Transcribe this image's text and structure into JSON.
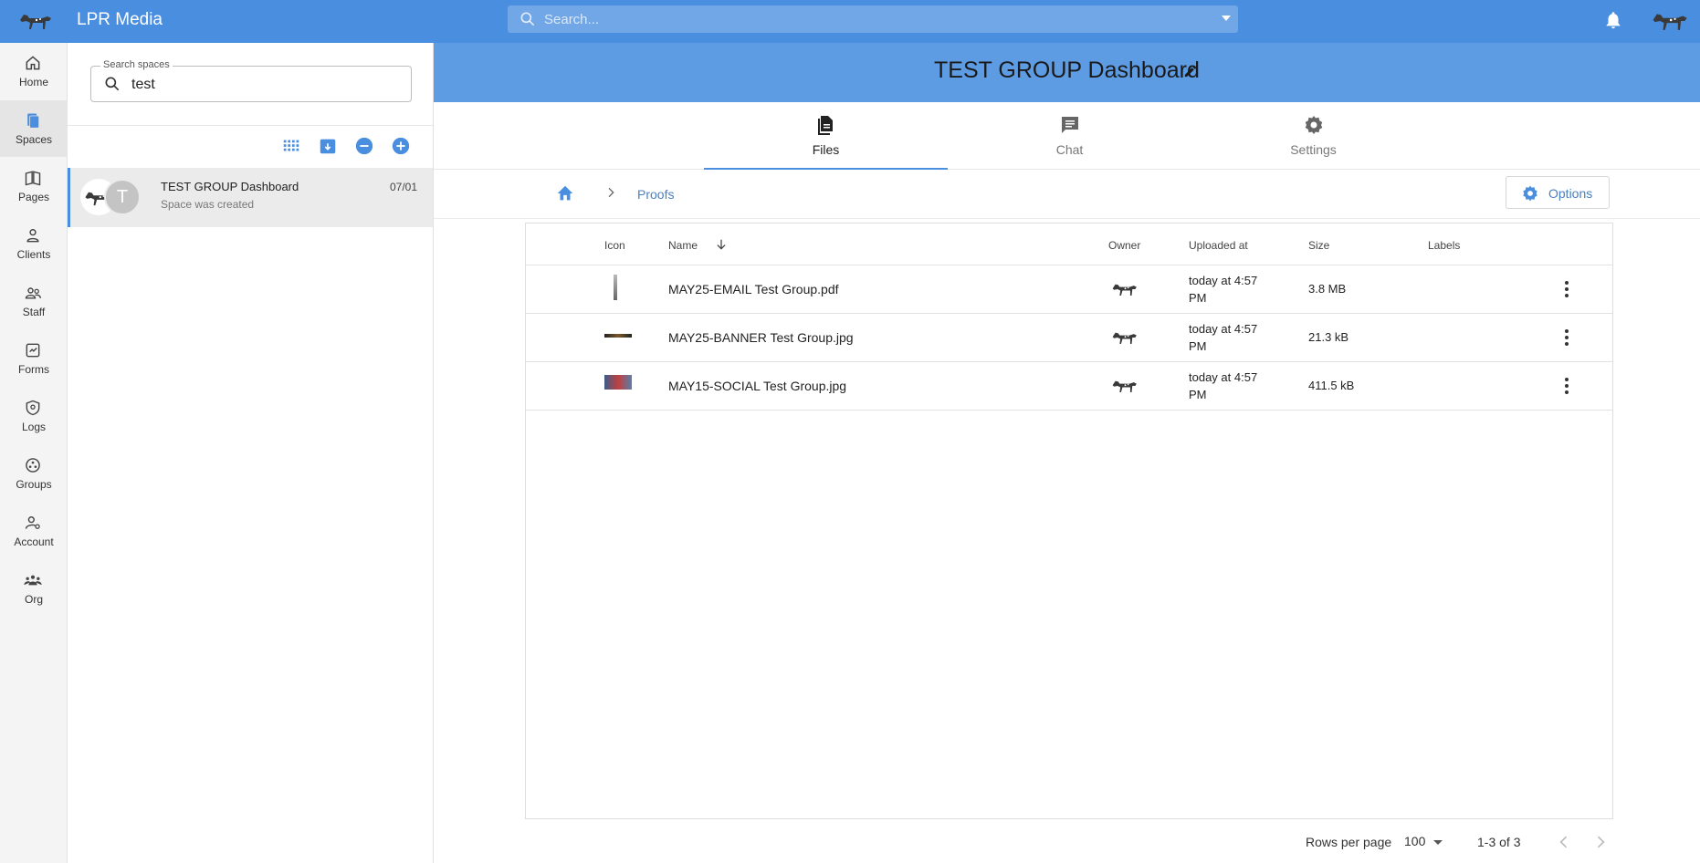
{
  "topbar": {
    "brand": "LPR Media",
    "search_placeholder": "Search..."
  },
  "leftnav": {
    "items": [
      {
        "label": "Home",
        "icon": "home-icon"
      },
      {
        "label": "Spaces",
        "icon": "spaces-icon"
      },
      {
        "label": "Pages",
        "icon": "pages-icon"
      },
      {
        "label": "Clients",
        "icon": "person-icon"
      },
      {
        "label": "Staff",
        "icon": "staff-icon"
      },
      {
        "label": "Forms",
        "icon": "forms-icon"
      },
      {
        "label": "Logs",
        "icon": "shield-icon"
      },
      {
        "label": "Groups",
        "icon": "groups-icon"
      },
      {
        "label": "Account",
        "icon": "account-settings-icon"
      },
      {
        "label": "Org",
        "icon": "org-icon"
      }
    ],
    "active": "Spaces"
  },
  "spaces": {
    "search_label": "Search spaces",
    "search_value": "test",
    "list": [
      {
        "title": "TEST GROUP Dashboard",
        "subtitle": "Space was created",
        "date": "07/01",
        "avatar_letter": "T"
      }
    ]
  },
  "main": {
    "title": "TEST GROUP Dashboard",
    "tabs": [
      {
        "label": "Files",
        "icon": "files-icon",
        "active": true
      },
      {
        "label": "Chat",
        "icon": "chat-icon",
        "active": false
      },
      {
        "label": "Settings",
        "icon": "gear-icon",
        "active": false
      }
    ],
    "breadcrumb": {
      "folder": "Proofs"
    },
    "options_label": "Options",
    "table": {
      "columns": [
        "Icon",
        "Name",
        "Owner",
        "Uploaded at",
        "Size",
        "Labels"
      ],
      "rows": [
        {
          "name": "MAY25-EMAIL Test Group.pdf",
          "uploaded": "today at 4:57 PM",
          "size": "3.8 MB",
          "labels": ""
        },
        {
          "name": "MAY25-BANNER Test Group.jpg",
          "uploaded": "today at 4:57 PM",
          "size": "21.3 kB",
          "labels": ""
        },
        {
          "name": "MAY15-SOCIAL Test Group.jpg",
          "uploaded": "today at 4:57 PM",
          "size": "411.5 kB",
          "labels": ""
        }
      ]
    },
    "pagination": {
      "rows_per_page_label": "Rows per page",
      "rows_per_page": "100",
      "range": "1-3 of 3"
    }
  },
  "colors": {
    "accent": "#4a8ee0",
    "header": "#5d9be3",
    "link": "#4a7fbf"
  }
}
